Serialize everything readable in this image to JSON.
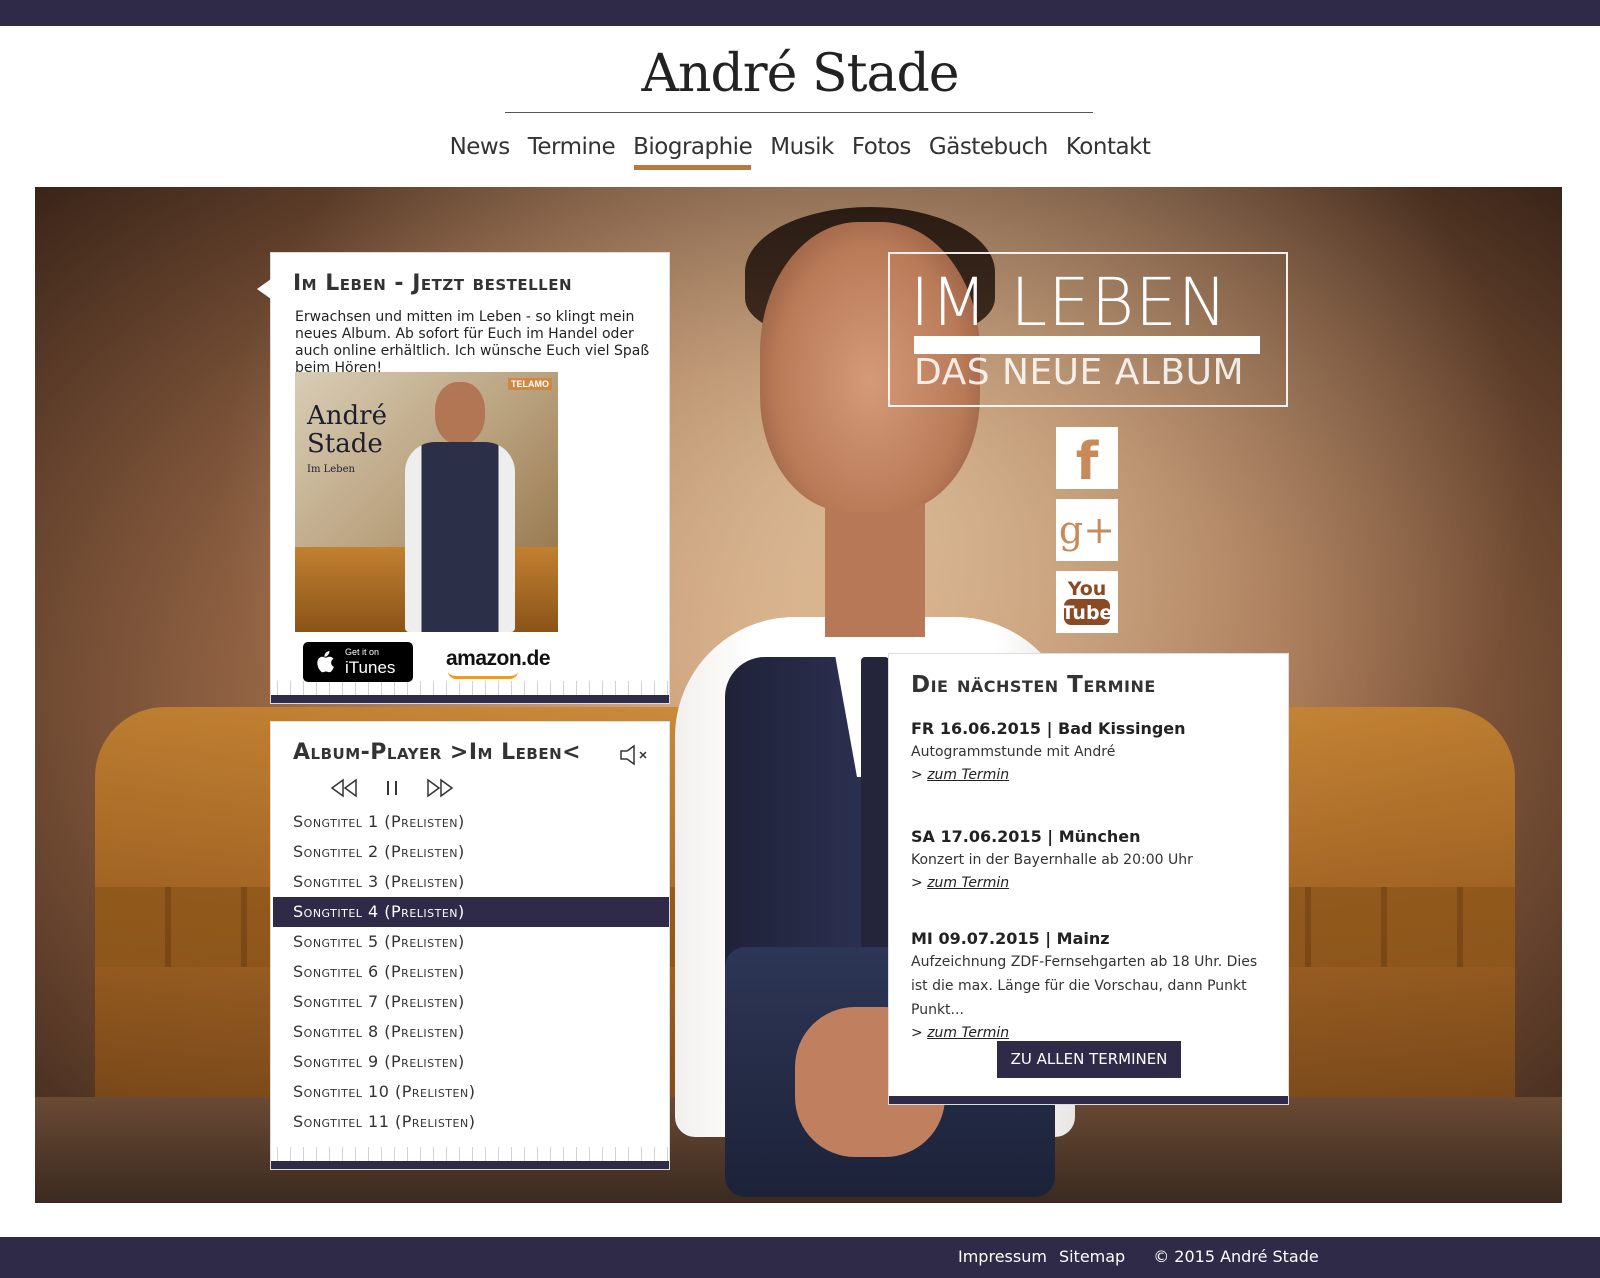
{
  "site": {
    "title": "André Stade"
  },
  "nav": {
    "items": [
      {
        "label": "News"
      },
      {
        "label": "Termine"
      },
      {
        "label": "Biographie",
        "active": true
      },
      {
        "label": "Musik"
      },
      {
        "label": "Fotos"
      },
      {
        "label": "Gästebuch"
      },
      {
        "label": "Kontakt"
      }
    ]
  },
  "order_panel": {
    "title": "Im Leben - Jetzt bestellen",
    "text": "Erwachsen und mitten im Leben - so klingt mein neues Album. Ab sofort für Euch im Handel oder auch online erhältlich. Ich wünsche Euch viel Spaß beim Hören!",
    "cover": {
      "artist": "André Stade",
      "album": "Im Leben",
      "label": "TELAMO"
    },
    "itunes": {
      "small": "Get it on",
      "big": "iTunes"
    },
    "amazon": "amazon.de"
  },
  "player": {
    "title": "Album-Player >Im Leben<",
    "tracks": [
      "Songtitel 1 (Prelisten)",
      "Songtitel 2 (Prelisten)",
      "Songtitel 3 (Prelisten)",
      "Songtitel 4 (Prelisten)",
      "Songtitel 5 (Prelisten)",
      "Songtitel 6 (Prelisten)",
      "Songtitel 7 (Prelisten)",
      "Songtitel 8 (Prelisten)",
      "Songtitel 9 (Prelisten)",
      "Songtitel 10 (Prelisten)",
      "Songtitel 11 (Prelisten)"
    ],
    "active_track_index": 3
  },
  "banner": {
    "line1": "IM LEBEN",
    "line2": "DAS NEUE ALBUM"
  },
  "social": {
    "facebook": "f",
    "googleplus": "g+",
    "youtube_top": "You",
    "youtube_bottom": "Tube"
  },
  "events": {
    "title": "Die nächsten Termine",
    "items": [
      {
        "date": "FR 16.06.2015",
        "place": "Bad Kissingen",
        "desc": "Autogrammstunde mit André",
        "link": "zum Termin"
      },
      {
        "date": "SA 17.06.2015",
        "place": "München",
        "desc": "Konzert in der Bayernhalle ab 20:00 Uhr",
        "link": "zum Termin"
      },
      {
        "date": "MI 09.07.2015",
        "place": "Mainz",
        "desc": "Aufzeichnung ZDF-Fernsehgarten ab 18 Uhr. Dies ist die max. Länge für die Vorschau, dann Punkt Punkt...",
        "link": "zum Termin"
      }
    ],
    "all_button": "ZU ALLEN TERMINEN"
  },
  "footer": {
    "impressum": "Impressum",
    "sitemap": "Sitemap",
    "copyright": "© 2015 André Stade"
  },
  "colors": {
    "primary": "#2e2a47",
    "accent": "#b87a3e"
  }
}
